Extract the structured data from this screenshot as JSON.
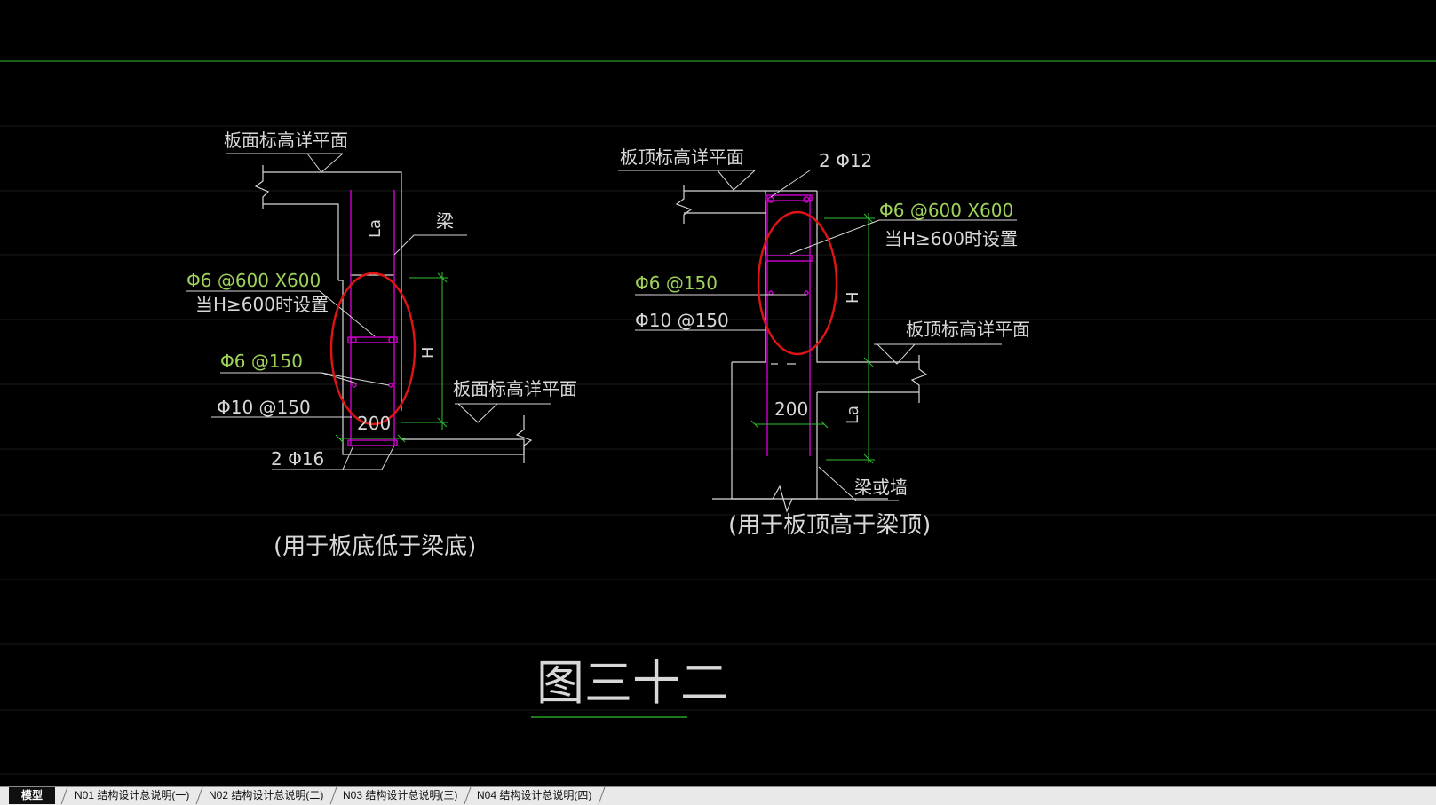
{
  "colors": {
    "background": "#000000",
    "line_white": "#d8d8d8",
    "line_green": "#30c030",
    "text_green": "#9fd25a",
    "line_magenta": "#d000d0",
    "highlight_red": "#e01414",
    "dim_green": "#2ed82e"
  },
  "drawing": {
    "left": {
      "slab_top_label": "板面标高详平面",
      "beam_label": "梁",
      "la_label": "La",
      "stirrup_tie_label": "Φ6 @600 X600",
      "stirrup_tie_condition": "当H≥600时设置",
      "h_label": "H",
      "side_bar_label": "Φ6 @150",
      "stirrup_label": "Φ10 @150",
      "slab_top_label2": "板面标高详平面",
      "width_label": "200",
      "bottom_bar_label": "2 Φ16",
      "caption": "(用于板底低于梁底)"
    },
    "right": {
      "slab_top_label": "板顶标高详平面",
      "top_bar_label": "2 Φ12",
      "stirrup_tie_label": "Φ6 @600 X600",
      "stirrup_tie_condition": "当H≥600时设置",
      "side_bar_label": "Φ6 @150",
      "h_label": "H",
      "stirrup_label": "Φ10 @150",
      "slab_top_label2": "板顶标高详平面",
      "width_label": "200",
      "la_label": "La",
      "beam_or_wall_label": "梁或墙",
      "caption": "(用于板顶高于梁顶)"
    },
    "figure_title": "图三十二"
  },
  "tabs": [
    {
      "label": "模型",
      "active": true
    },
    {
      "label": "N01 结构设计总说明(一)",
      "active": false
    },
    {
      "label": "N02 结构设计总说明(二)",
      "active": false
    },
    {
      "label": "N03 结构设计总说明(三)",
      "active": false
    },
    {
      "label": "N04 结构设计总说明(四)",
      "active": false
    }
  ]
}
